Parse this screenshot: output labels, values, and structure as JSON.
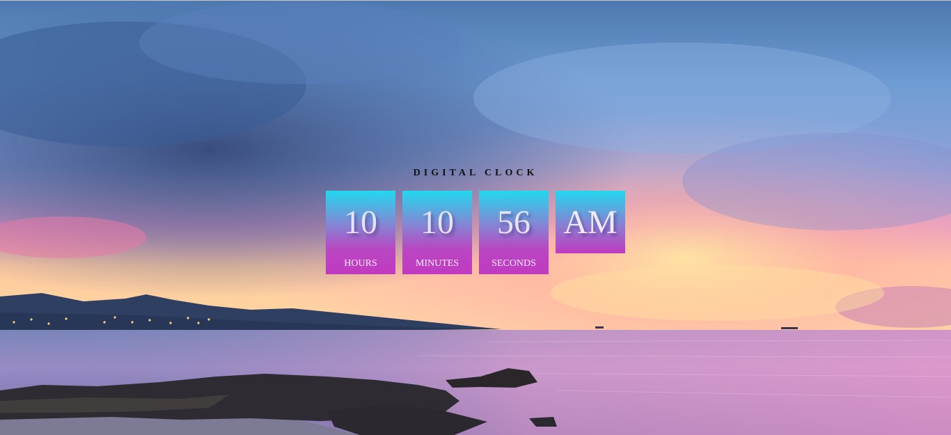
{
  "clock": {
    "title": "DIGITAL CLOCK",
    "hours": "10",
    "minutes": "10",
    "seconds": "56",
    "ampm": "AM",
    "hours_label": "HOURS",
    "minutes_label": "MINUTES",
    "seconds_label": "SECONDS"
  },
  "colors": {
    "box_top": "#22d8ef",
    "box_bottom": "#c03ac0",
    "title_text": "#111111"
  }
}
